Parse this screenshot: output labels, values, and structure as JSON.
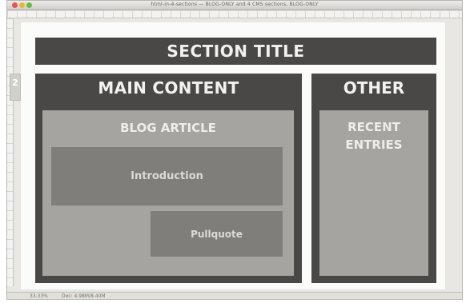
{
  "window": {
    "title": "html-in-4-sections — BLOG-ONLY and 4 CMS sections, BLOG-ONLY",
    "side_tab_label": "2"
  },
  "statusbar": {
    "zoom": "33.33%",
    "doc": "Doc: 4.98M/8.40M"
  },
  "layout": {
    "section_title": "SECTION TITLE",
    "main_content": {
      "heading": "MAIN CONTENT",
      "blog_article": {
        "heading": "BLOG ARTICLE",
        "introduction": "Introduction",
        "pullquote": "Pullquote"
      }
    },
    "other": {
      "heading": "OTHER",
      "recent_entries": "RECENT\nENTRIES"
    }
  },
  "colors": {
    "dark_block": "#4a4846",
    "mid_block": "#a6a4a1",
    "inner_block": "#807e7b"
  }
}
